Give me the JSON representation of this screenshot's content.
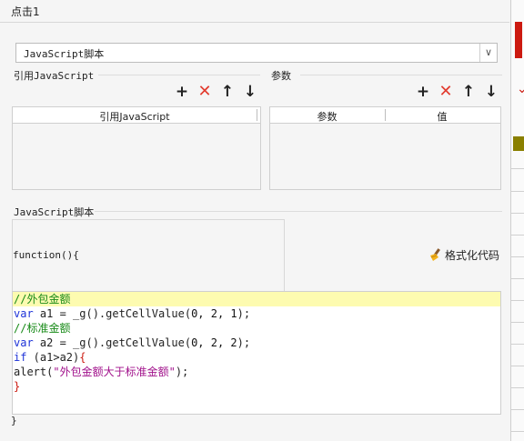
{
  "window": {
    "title": "点击1"
  },
  "script_type": {
    "selected": "JavaScript脚本"
  },
  "ref_js": {
    "group_label": "引用JavaScript",
    "column_header": "引用JavaScript"
  },
  "params": {
    "group_label": "参数",
    "columns": [
      "参数",
      "值"
    ]
  },
  "toolbar": {
    "add": "+",
    "delete": "✕",
    "up": "↑",
    "down": "↓"
  },
  "script": {
    "group_label": "JavaScript脚本",
    "function_header": "function(){",
    "format_button": "格式化代码",
    "closing": "}",
    "code": {
      "l1_comment": "//外包金额",
      "l2_kw": "var",
      "l2_rest_a": " a1 = _g().getCellValue(",
      "l2_args": "0, 2, 1",
      "l2_end": ");",
      "l3_comment": "//标准金额",
      "l4_kw": "var",
      "l4_rest_a": " a2 = _g().getCellValue(",
      "l4_args": "0, 2, 2",
      "l4_end": ");",
      "l5_kw": "if",
      "l5_rest": " (a1>a2)",
      "l5_brace": "{",
      "l6_fn": "alert(",
      "l6_str": "\"外包金额大于标准金额\"",
      "l6_end": ");",
      "l7_brace": "}"
    }
  },
  "colors": {
    "accent_red": "#e23b2e",
    "comment_green": "#178a17",
    "keyword_blue": "#1e33d8",
    "string_magenta": "#a1118b",
    "highlight": "#fdfbb0"
  }
}
